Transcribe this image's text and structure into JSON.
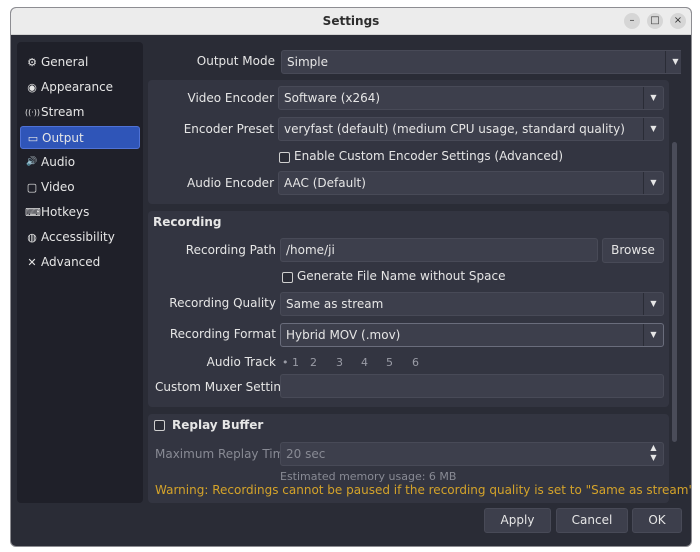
{
  "window": {
    "title": "Settings"
  },
  "window_controls": {
    "minimize": "–",
    "maximize": "□",
    "close": "×"
  },
  "sidebar": {
    "items": [
      {
        "label": "General",
        "icon": "gear-icon",
        "glyph": "⚙"
      },
      {
        "label": "Appearance",
        "icon": "appearance-icon",
        "glyph": "◉"
      },
      {
        "label": "Stream",
        "icon": "stream-icon",
        "glyph": "((·))"
      },
      {
        "label": "Output",
        "icon": "output-icon",
        "glyph": "▭"
      },
      {
        "label": "Audio",
        "icon": "speaker-icon",
        "glyph": "🔊"
      },
      {
        "label": "Video",
        "icon": "monitor-icon",
        "glyph": "▢"
      },
      {
        "label": "Hotkeys",
        "icon": "keyboard-icon",
        "glyph": "⌨"
      },
      {
        "label": "Accessibility",
        "icon": "accessibility-icon",
        "glyph": "◍"
      },
      {
        "label": "Advanced",
        "icon": "tools-icon",
        "glyph": "✕"
      }
    ],
    "active_index": 3
  },
  "output": {
    "output_mode_label": "Output Mode",
    "output_mode_value": "Simple",
    "video_encoder_label": "Video Encoder",
    "video_encoder_value": "Software (x264)",
    "encoder_preset_label": "Encoder Preset",
    "encoder_preset_value": "veryfast (default) (medium CPU usage, standard quality)",
    "custom_encoder_label": "Enable Custom Encoder Settings (Advanced)",
    "audio_encoder_label": "Audio Encoder",
    "audio_encoder_value": "AAC (Default)"
  },
  "recording": {
    "section_title": "Recording",
    "path_label": "Recording Path",
    "path_value": "/home/ji",
    "browse_label": "Browse",
    "gen_filename_label": "Generate File Name without Space",
    "quality_label": "Recording Quality",
    "quality_value": "Same as stream",
    "format_label": "Recording Format",
    "format_value": "Hybrid MOV (.mov)",
    "audio_track_label": "Audio Track",
    "audio_tracks": [
      "1",
      "2",
      "3",
      "4",
      "5",
      "6"
    ],
    "muxer_label": "Custom Muxer Settings",
    "muxer_value": ""
  },
  "replay": {
    "section_title": "Replay Buffer",
    "max_time_label": "Maximum Replay Time",
    "max_time_value": "20 sec",
    "memory_text": "Estimated memory usage: 6 MB"
  },
  "warning_text": "Warning: Recordings cannot be paused if the recording quality is set to \"Same as stream\".",
  "buttons": {
    "apply": "Apply",
    "cancel": "Cancel",
    "ok": "OK"
  },
  "colors": {
    "accent": "#2f55b8",
    "warning": "#d4a32a",
    "background": "#2a2c36"
  }
}
